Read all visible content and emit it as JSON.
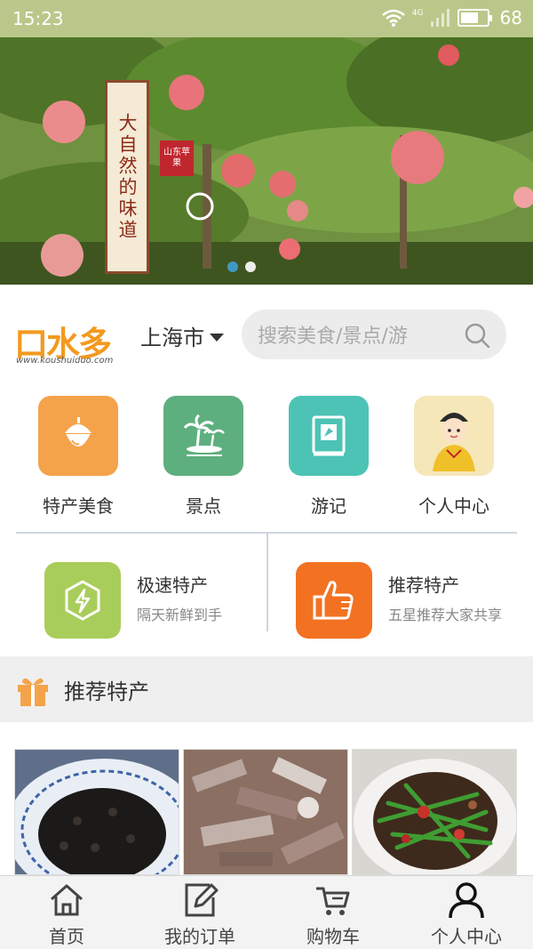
{
  "status_bar": {
    "time": "15:23",
    "network": "4G",
    "battery": "68",
    "battery_level": 0.68
  },
  "banner": {
    "sign_text": "大自然的味道",
    "stamp_text": "山东苹果",
    "slide_count": 2,
    "active_slide": 1
  },
  "header": {
    "logo_text": "口水多",
    "logo_url": "www.koushuiduo.com",
    "city": "上海市",
    "search_placeholder": "搜索美食/景点/游"
  },
  "categories": [
    {
      "label": "特产美食",
      "icon": "acorn-icon",
      "color": "#f5a34a"
    },
    {
      "label": "景点",
      "icon": "palm-island-icon",
      "color": "#5eaf7e"
    },
    {
      "label": "游记",
      "icon": "compass-book-icon",
      "color": "#4cc3b5"
    },
    {
      "label": "个人中心",
      "icon": "avatar-icon",
      "color": "#f6e7b8"
    }
  ],
  "features": [
    {
      "title": "极速特产",
      "subtitle": "隔天新鲜到手",
      "icon": "lightning-hexagon-icon",
      "color": "#a9cd5b"
    },
    {
      "title": "推荐特产",
      "subtitle": "五星推荐大家共享",
      "icon": "thumbs-up-icon",
      "color": "#f27222"
    }
  ],
  "section": {
    "title": "推荐特产",
    "icon": "gift-icon",
    "icon_color": "#f5a34a"
  },
  "products": [
    {
      "name": "product-braised-beans"
    },
    {
      "name": "product-sliced-meat"
    },
    {
      "name": "product-stir-fry-greens"
    }
  ],
  "tabbar": [
    {
      "label": "首页",
      "icon": "home-icon"
    },
    {
      "label": "我的订单",
      "icon": "edit-order-icon"
    },
    {
      "label": "购物车",
      "icon": "cart-icon"
    },
    {
      "label": "个人中心",
      "icon": "user-icon"
    }
  ]
}
